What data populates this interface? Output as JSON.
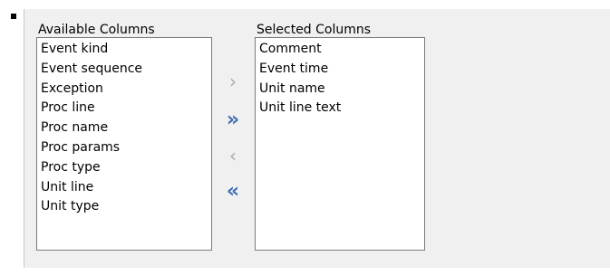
{
  "available": {
    "label": "Available Columns",
    "items": [
      "Event kind",
      "Event sequence",
      "Exception",
      "Proc line",
      "Proc name",
      "Proc params",
      "Proc type",
      "Unit line",
      "Unit type"
    ]
  },
  "selected": {
    "label": "Selected Columns",
    "items": [
      "Comment",
      "Event time",
      "Unit name",
      "Unit line text"
    ]
  },
  "buttons": {
    "add_one": "›",
    "add_all": "»",
    "remove_one": "‹",
    "remove_all": "«"
  },
  "colors": {
    "accent": "#3f6fb0",
    "disabled": "#a8a8a8",
    "panel": "#f0f0f0",
    "list_border": "#7a7a7a"
  },
  "icons": {
    "bullet": "square-bullet-icon",
    "add_one": "chevron-right-icon",
    "add_all": "double-chevron-right-icon",
    "remove_one": "chevron-left-icon",
    "remove_all": "double-chevron-left-icon"
  }
}
